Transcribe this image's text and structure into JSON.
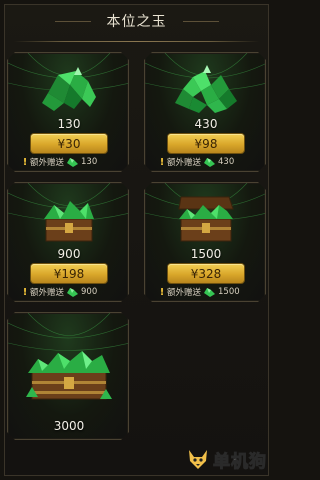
{
  "header": {
    "title": "本位之玉"
  },
  "products": [
    {
      "amount": "130",
      "price": "¥30",
      "bonus_label": "额外赠送",
      "bonus_amount": "130",
      "art": "gem-pile-small"
    },
    {
      "amount": "430",
      "price": "¥98",
      "bonus_label": "额外赠送",
      "bonus_amount": "430",
      "art": "gem-pile-large"
    },
    {
      "amount": "900",
      "price": "¥198",
      "bonus_label": "额外赠送",
      "bonus_amount": "900",
      "art": "gem-chest-small"
    },
    {
      "amount": "1500",
      "price": "¥328",
      "bonus_label": "额外赠送",
      "bonus_amount": "1500",
      "art": "gem-chest-open"
    },
    {
      "amount": "3000",
      "art": "gem-chest-large"
    }
  ],
  "watermark": {
    "text": "单机狗"
  },
  "colors": {
    "gold": "#e2b33a",
    "gem_green": "#2fbf4a",
    "panel": "#15130f"
  }
}
